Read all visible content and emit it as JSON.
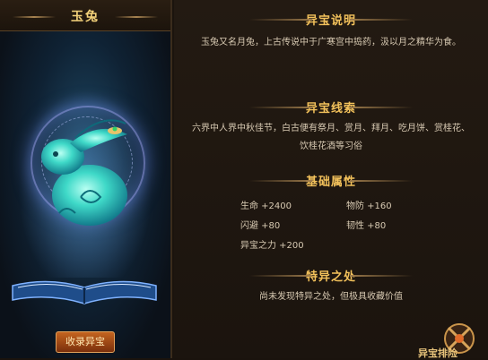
{
  "left_panel": {
    "title": "玉兔",
    "collect_button": "收录异宝"
  },
  "sections": {
    "description": {
      "title": "异宝说明",
      "text": "玉兔又名月兔，上古传说中于广寒宫中捣药，汲以月之精华为食。"
    },
    "clue": {
      "title": "异宝线索",
      "text_line1": "六界中人界中秋佳节，白古便有祭月、赏月、拜月、吃月饼、赏桂花、",
      "text_line2": "饮桂花酒等习俗"
    },
    "attributes": {
      "title": "基础属性",
      "items": [
        "生命 +2400",
        "物防 +160",
        "闪避 +80",
        "韧性 +80",
        "异宝之力 +200"
      ]
    },
    "special": {
      "title": "特异之处",
      "text": "尚未发现特异之处，但极具收藏价值"
    }
  },
  "corner_badge_text": "异宝排险",
  "colors": {
    "title_gold": "#f2c15b",
    "body_text": "#d7c9b2",
    "button_orange": "#c4641f",
    "jade": "#3fd9c8"
  }
}
